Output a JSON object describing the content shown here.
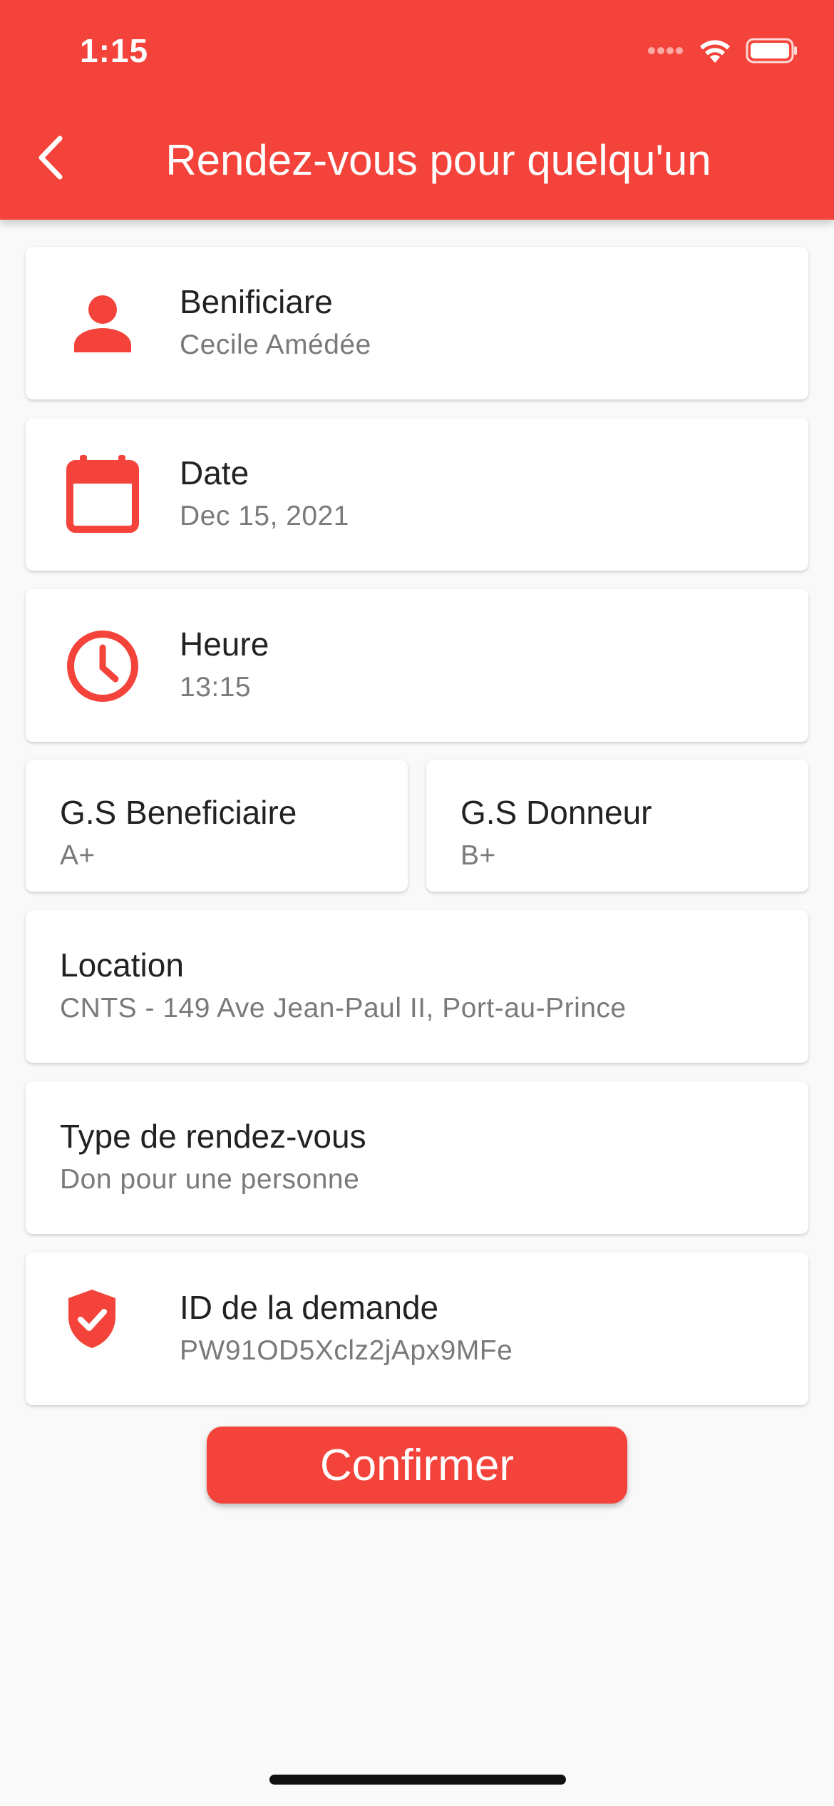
{
  "status_bar": {
    "time": "1:15"
  },
  "app_bar": {
    "title": "Rendez-vous pour quelqu'un"
  },
  "cards": {
    "beneficiary": {
      "label": "Benificiare",
      "value": "Cecile Amédée"
    },
    "date": {
      "label": "Date",
      "value": "Dec 15, 2021"
    },
    "time": {
      "label": "Heure",
      "value": "13:15"
    },
    "gs_beneficiary": {
      "label": "G.S Beneficiaire",
      "value": "A+"
    },
    "gs_donor": {
      "label": "G.S Donneur",
      "value": "B+"
    },
    "location": {
      "label": "Location",
      "value": "CNTS - 149 Ave Jean-Paul II, Port-au-Prince"
    },
    "type": {
      "label": "Type de rendez-vous",
      "value": "Don pour une personne"
    },
    "request_id": {
      "label": "ID de la demande",
      "value": "PW91OD5Xclz2jApx9MFe"
    }
  },
  "confirm_button": {
    "label": "Confirmer"
  },
  "colors": {
    "accent": "#f4433a",
    "background": "#f9f9f9",
    "card": "#ffffff"
  }
}
